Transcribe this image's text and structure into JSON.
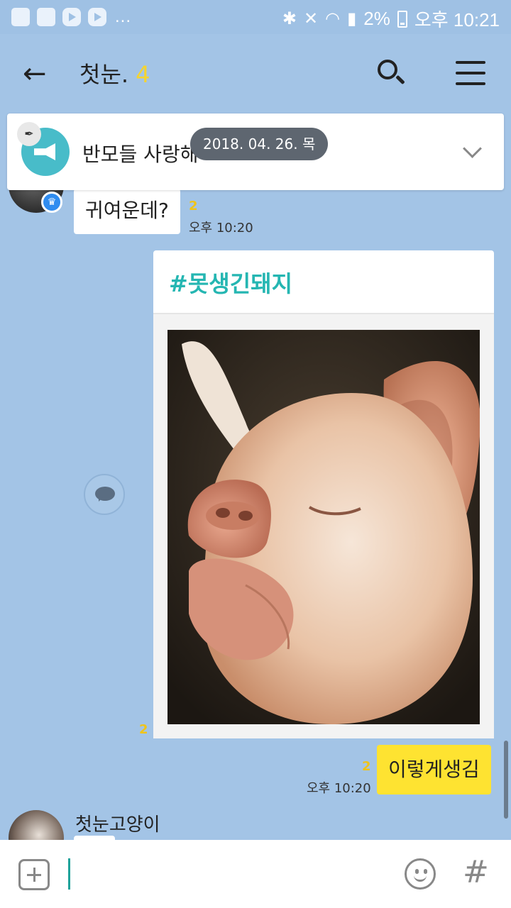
{
  "status_bar": {
    "battery": "2%",
    "time": "오후 10:21",
    "overflow": "..."
  },
  "header": {
    "title": "첫눈.",
    "member_count": "4"
  },
  "notice": {
    "text": "반모들 사랑해"
  },
  "date_divider": "2018. 04. 26. 목",
  "messages": [
    {
      "text": "귀여운데?",
      "unread": "2",
      "time": "오후 10:20"
    },
    {
      "card_title": "#못생긴돼지",
      "unread": "2"
    },
    {
      "text": "이렇게생김",
      "unread": "2",
      "time": "오후 10:20"
    }
  ],
  "next_sender": "첫눈고양이",
  "icons": {
    "back": "arrow-left-icon",
    "search": "search-icon",
    "menu": "hamburger-menu-icon",
    "notice": "megaphone-icon",
    "pin": "pin-icon",
    "attach": "plus-icon",
    "emoji": "smiley-icon",
    "hashtag": "hashtag-icon"
  },
  "colors": {
    "background": "#a3c4e6",
    "my_bubble": "#fee331",
    "unread": "#f0c419",
    "hashtag": "#25b6b2",
    "notice_icon": "#48bcc9"
  }
}
